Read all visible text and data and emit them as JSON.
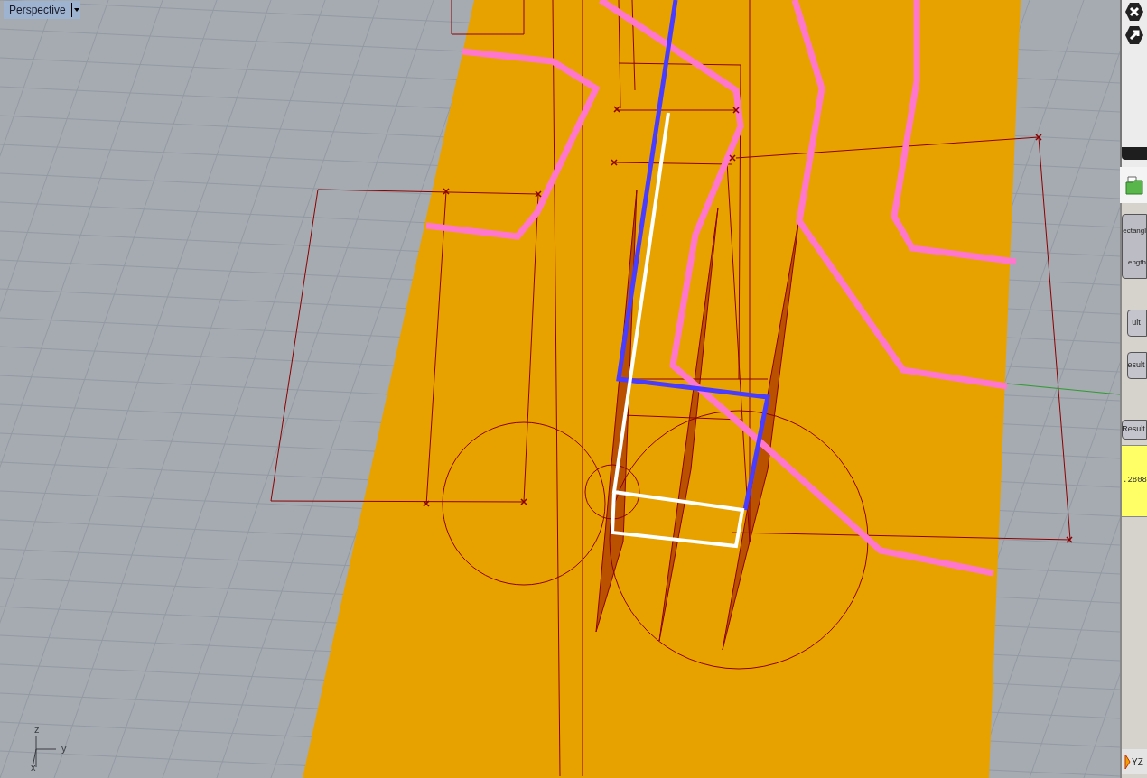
{
  "viewport": {
    "title": "Perspective",
    "axis_labels": {
      "z": "z",
      "y": "y",
      "x": "x"
    }
  },
  "canvas": {
    "components": [
      {
        "kind": "component",
        "label": "ectangl"
      },
      {
        "kind": "component",
        "label": "ength"
      },
      {
        "kind": "component",
        "label": "ult"
      },
      {
        "kind": "component",
        "label": "esult"
      },
      {
        "kind": "component",
        "label": "Result"
      }
    ],
    "panel_value": ".2808",
    "bottom_button": "YZ"
  }
}
